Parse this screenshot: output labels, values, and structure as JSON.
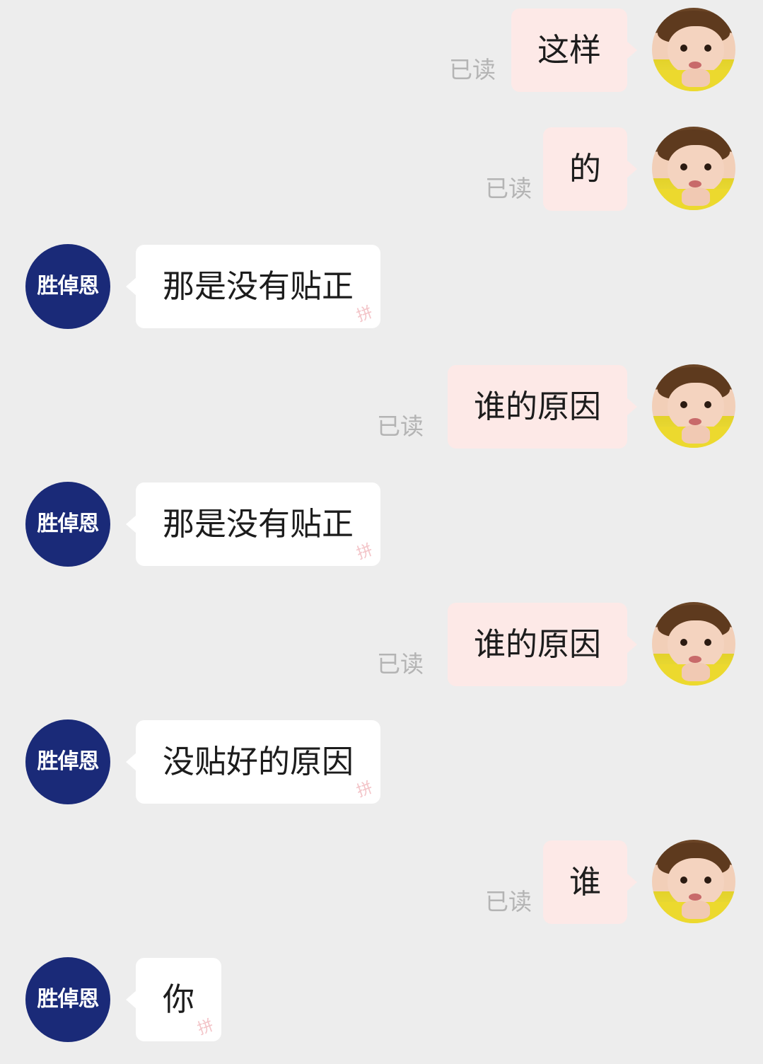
{
  "chat": {
    "incoming_name_badge": "胜倬恩",
    "read_status": "已读",
    "messages": [
      {
        "dir": "out",
        "text": "这样",
        "status": "已读"
      },
      {
        "dir": "out",
        "text": "的",
        "status": "已读"
      },
      {
        "dir": "in",
        "text": "那是没有贴正"
      },
      {
        "dir": "out",
        "text": "谁的原因",
        "status": "已读"
      },
      {
        "dir": "in",
        "text": "那是没有贴正"
      },
      {
        "dir": "out",
        "text": "谁的原因",
        "status": "已读"
      },
      {
        "dir": "in",
        "text": "没贴好的原因"
      },
      {
        "dir": "out",
        "text": "谁",
        "status": "已读"
      },
      {
        "dir": "in",
        "text": "你"
      }
    ]
  },
  "colors": {
    "background": "#ededed",
    "outgoing_bubble": "#fde9e7",
    "incoming_bubble": "#ffffff",
    "badge_background": "#1a2a78",
    "read_text": "#b4b4b4"
  },
  "icons": {
    "outgoing_avatar": "child-photo-avatar",
    "incoming_avatar": "name-badge-avatar",
    "bubble_watermark": "pin-stamp-icon"
  }
}
